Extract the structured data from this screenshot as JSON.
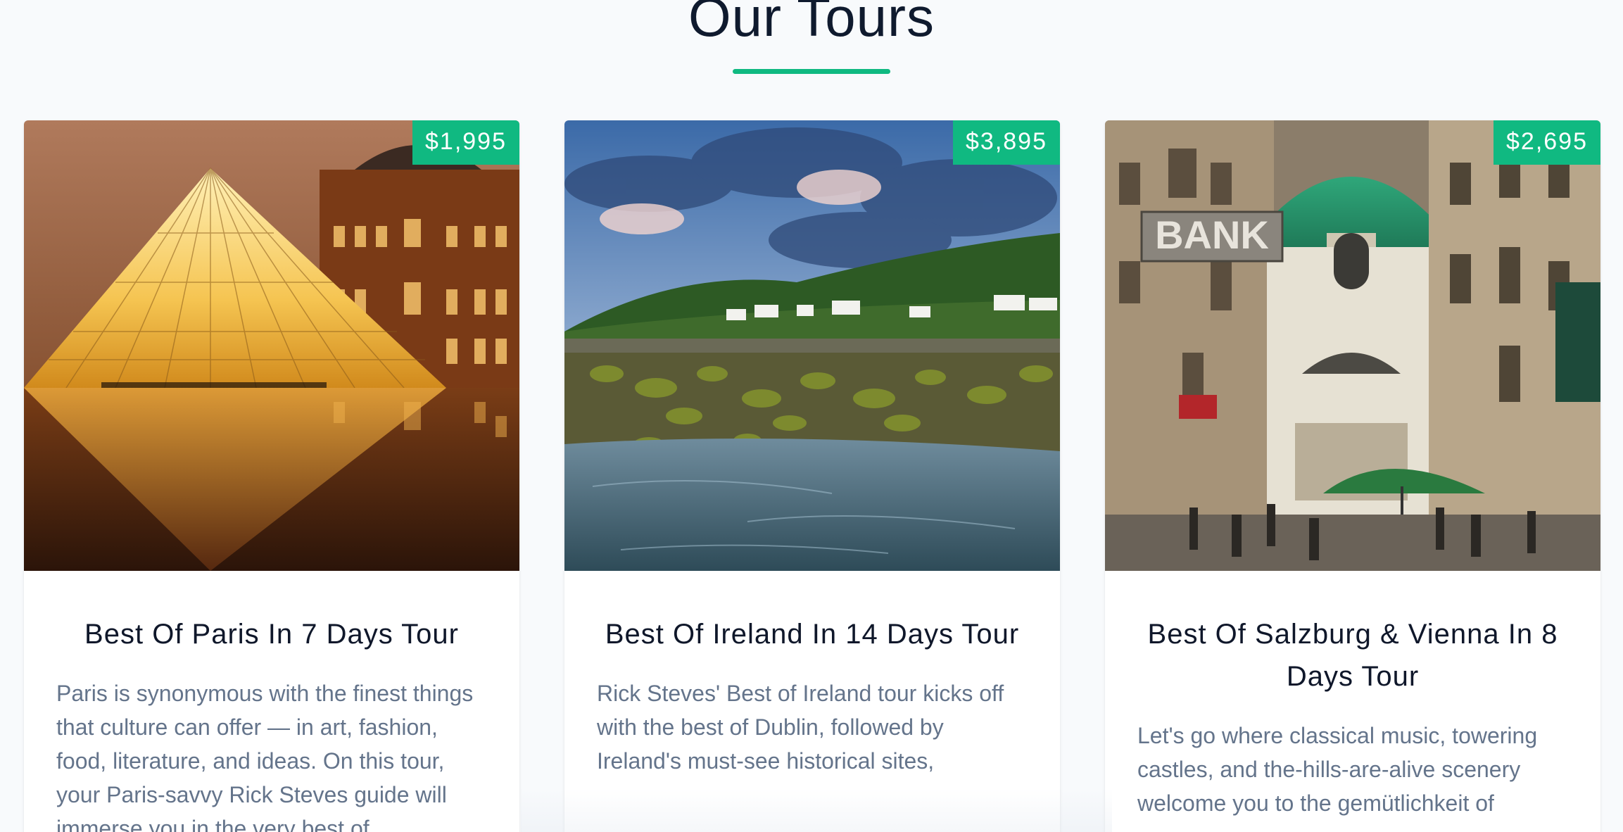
{
  "section": {
    "title": "Our Tours"
  },
  "colors": {
    "accent": "#10b981",
    "title_text": "#0f172a",
    "body_text": "#64748b",
    "background": "#f8fafc"
  },
  "tours": [
    {
      "price": "$1,995",
      "title": "Best Of Paris In 7 Days Tour",
      "description": "Paris is synonymous with the finest things that culture can offer — in art, fashion, food, literature, and ideas. On this tour, your Paris-savvy Rick Steves guide will immerse you in the very best of...",
      "image": "louvre-pyramid-photo"
    },
    {
      "price": "$3,895",
      "title": "Best Of Ireland In 14 Days Tour",
      "description": "Rick Steves' Best of Ireland tour kicks off with the best of Dublin, followed by Ireland's must-see historical sites,",
      "image": "irish-coast-photo"
    },
    {
      "price": "$2,695",
      "title": "Best Of Salzburg & Vienna In 8 Days Tour",
      "description": "Let's go where classical music, towering castles, and the-hills-are-alive scenery welcome you to the gemütlichkeit of",
      "image": "vienna-street-photo",
      "sign_text": "BANK"
    }
  ]
}
